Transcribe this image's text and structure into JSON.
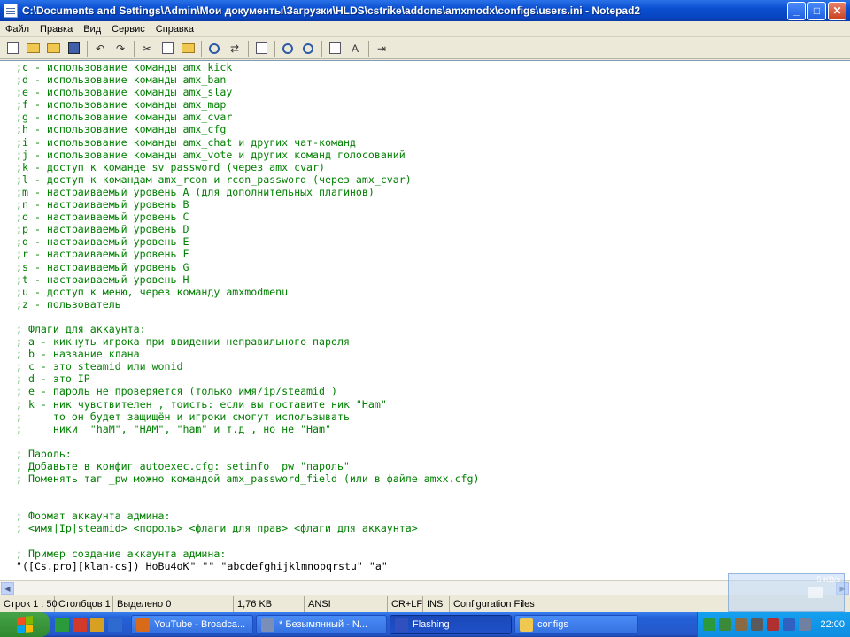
{
  "window": {
    "title": "C:\\Documents and Settings\\Admin\\Мои документы\\Загрузки\\HLDS\\cstrike\\addons\\amxmodx\\configs\\users.ini - Notepad2",
    "minimize": "_",
    "maximize": "□",
    "close": "✕"
  },
  "menu": [
    "Файл",
    "Правка",
    "Вид",
    "Сервис",
    "Справка"
  ],
  "toolbar_icons": [
    "new-icon",
    "open-icon",
    "browse-icon",
    "save-icon",
    "undo-icon",
    "redo-icon",
    "cut-icon",
    "copy-icon",
    "paste-icon",
    "find-icon",
    "replace-icon",
    "wordwrap-icon",
    "zoom-in-icon",
    "zoom-out-icon",
    "view-icon",
    "scheme-icon",
    "exit-icon"
  ],
  "editor": {
    "lines": [
      ";c - использование команды amx_kick",
      ";d - использование команды amx_ban",
      ";e - использование команды amx_slay",
      ";f - использование команды amx_map",
      ";g - использование команды amx_cvar",
      ";h - использование команды amx_cfg",
      ";i - использование команды amx_chat и других чат-команд",
      ";j - использование команды amx_vote и других команд голосований",
      ";k - доступ к команде sv_password (через amx_cvar)",
      ";l - доступ к командам amx_rcon и rcon_password (через amx_cvar)",
      ";m - настраиваемый уровень A (для дополнительных плагинов)",
      ";n - настраиваемый уровень B",
      ";o - настраиваемый уровень C",
      ";p - настраиваемый уровень D",
      ";q - настраиваемый уровень E",
      ";r - настраиваемый уровень F",
      ";s - настраиваемый уровень G",
      ";t - настраиваемый уровень H",
      ";u - доступ к меню, через команду amxmodmenu",
      ";z - пользователь",
      "",
      "; Флаги для аккаунта:",
      "; a - кикнуть игрока при ввидении неправильного пароля",
      "; b - название клана",
      "; c - это steamid или wonid",
      "; d - это IP",
      "; e - пароль не проверяется (только имя/ip/steamid )",
      "; k - ник чувствителен , тоисть: если вы поставите ник \"Ham\"",
      ";     то он будет защищён и игроки смогут использывать",
      ";     ники  \"haM\", \"HAM\", \"ham\" и т.д , но не \"Ham\"",
      "",
      "; Пароль:",
      "; Добавьте в конфиг autoexec.cfg: setinfo _pw \"пароль\"",
      "; Поменять таг _pw можно командой amx_password_field (или в файле amxx.cfg)",
      "",
      "",
      "; Формат аккаунта админа:",
      "; <имя|Ip|steamid> <пороль> <флаги для прав> <флаги для аккаунта>",
      "",
      "; Пример создание аккаунта админа:"
    ],
    "last_line_before_cursor": "\"([Cs.pro][klan-cs])_HoBu4oK",
    "last_line_after_cursor": "\" \"\" \"abcdefghijklmnopqrstu\" \"a\""
  },
  "status": {
    "position": "Строк 1 : 50",
    "column": "Столбцов 1",
    "selection": "Выделено 0",
    "size": "1,76 KB",
    "encoding": "ANSI",
    "eol": "CR+LF",
    "mode": "INS",
    "scheme": "Configuration Files"
  },
  "net_popup": {
    "speed": "5 KB/s"
  },
  "taskbar": {
    "tasks": [
      {
        "label": "YouTube - Broadca...",
        "color": "#d86a1a",
        "active": false
      },
      {
        "label": "* Безымянный - N...",
        "color": "#7a8fb8",
        "active": false
      },
      {
        "label": "Flashing",
        "color": "#3050c0",
        "active": true
      },
      {
        "label": "configs",
        "color": "#f0c850",
        "active": false
      }
    ],
    "clock": "22:00"
  }
}
